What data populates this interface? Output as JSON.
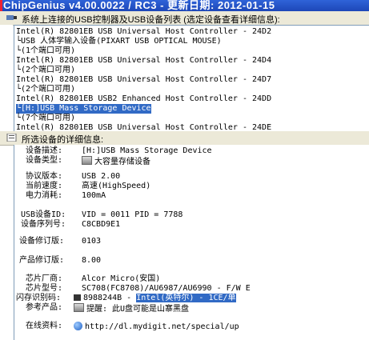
{
  "window": {
    "title": "ChipGenius v4.00.0022 / RC3 - 更新日期: 2012-01-15"
  },
  "device_list": {
    "header": "系统上连接的USB控制器及USB设备列表 (选定设备查看详细信息):",
    "items": [
      "Intel(R) 82801EB USB Universal Host Controller - 24D2",
      "└USB 人体学输入设备(PIXART USB OPTICAL MOUSE)",
      "└(1个端口可用)",
      "Intel(R) 82801EB USB Universal Host Controller - 24D4",
      "└(2个端口可用)",
      "Intel(R) 82801EB USB Universal Host Controller - 24D7",
      "└(2个端口可用)",
      "Intel(R) 82801EB USB2 Enhanced Host Controller - 24DD",
      "└[H:]USB Mass Storage Device",
      "└(7个端口可用)",
      "Intel(R) 82801EB USB Universal Host Controller - 24DE"
    ],
    "selected_index": 8
  },
  "details": {
    "header": "所选设备的详细信息:",
    "device_description": {
      "label": "设备描述:",
      "value": "[H:]USB Mass Storage Device"
    },
    "device_type": {
      "label": "设备类型:",
      "value": "大容量存储设备"
    },
    "protocol_version": {
      "label": "协议版本:",
      "value": "USB 2.00"
    },
    "current_speed": {
      "label": "当前速度:",
      "value": "高速(HighSpeed)"
    },
    "power": {
      "label": "电力消耗:",
      "value": "100mA"
    },
    "usb_id": {
      "label": "USB设备ID:",
      "value": "VID = 0011 PID = 7788"
    },
    "serial": {
      "label": "设备序列号:",
      "value": "C8CBD9E1"
    },
    "device_revision": {
      "label": "设备修订版:",
      "value": "0103"
    },
    "product_revision": {
      "label": "产品修订版:",
      "value": "8.00"
    },
    "chip_vendor": {
      "label": "芯片厂商:",
      "value": "Alcor Micro(安国)"
    },
    "chip_model": {
      "label": "芯片型号:",
      "value": "SC708(FC8708)/AU6987/AU6990 - F/W E"
    },
    "flash_id": {
      "label": "闪存识别码:",
      "value_plain": "8988244B - ",
      "value_highlight": "Intel(英特尔) - 1CE/单"
    },
    "reference": {
      "label": "参考产品:",
      "value": "提醒: 此U盘可能是山寨黑盘"
    },
    "online": {
      "label": "在线资料:",
      "value": "http://dl.mydigit.net/special/up"
    }
  }
}
